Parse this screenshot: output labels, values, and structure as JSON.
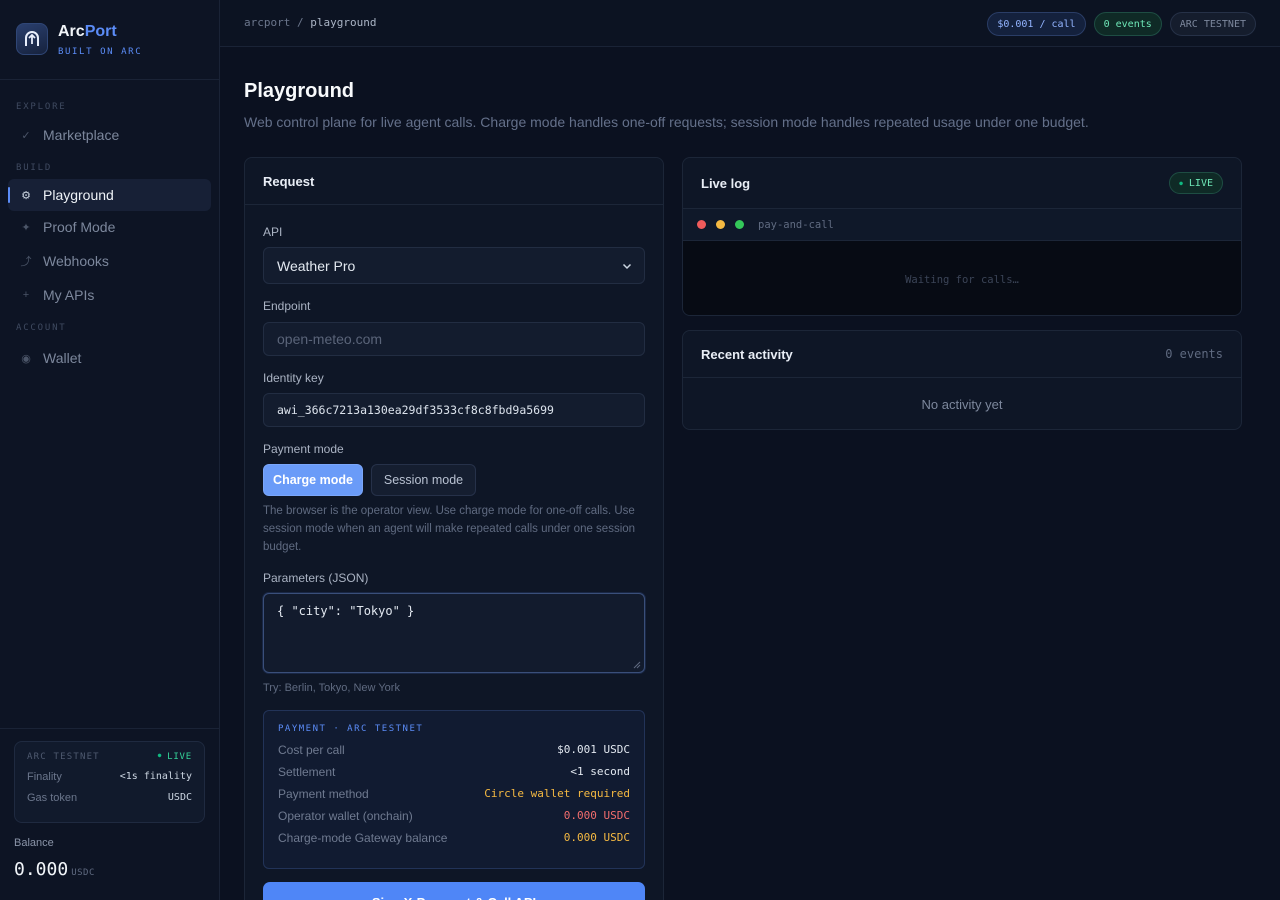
{
  "brand": {
    "name_a": "Arc",
    "name_b": "Port",
    "tagline": "BUILT ON ARC"
  },
  "nav": {
    "explore_label": "EXPLORE",
    "build_label": "BUILD",
    "account_label": "ACCOUNT",
    "items": [
      {
        "label": "Marketplace",
        "icon": "check-icon"
      },
      {
        "label": "Playground",
        "icon": "gear-icon",
        "active": true
      },
      {
        "label": "Proof Mode",
        "icon": "sparkle-icon"
      },
      {
        "label": "Webhooks",
        "icon": "curve-arrow-icon"
      },
      {
        "label": "My APIs",
        "icon": "plus-icon"
      },
      {
        "label": "Wallet",
        "icon": "circle-icon"
      }
    ]
  },
  "network": {
    "name": "ARC TESTNET",
    "status": "LIVE",
    "finality_label": "Finality",
    "finality_value": "<1s finality",
    "gas_label": "Gas token",
    "gas_value": "USDC"
  },
  "balance": {
    "label": "Balance",
    "value": "0.000",
    "unit": "USDC"
  },
  "topbar": {
    "crumb_root": "arcport",
    "crumb_sep": "/",
    "crumb_current": "playground",
    "price_chip": "$0.001 / call",
    "events_chip": "0 events",
    "network_chip": "ARC TESTNET"
  },
  "page": {
    "title": "Playground",
    "subtitle": "Web control plane for live agent calls. Charge mode handles one-off requests; session mode handles repeated usage under one budget."
  },
  "request": {
    "title": "Request",
    "api_label": "API",
    "api_value": "Weather Pro",
    "endpoint_label": "Endpoint",
    "endpoint_placeholder": "open-meteo.com",
    "identity_label": "Identity key",
    "identity_value": "awi_366c7213a130ea29df3533cf8c8fbd9a5699",
    "payment_mode_label": "Payment mode",
    "charge_mode": "Charge mode",
    "session_mode": "Session mode",
    "mode_hint": "The browser is the operator view. Use charge mode for one-off calls. Use session mode when an agent will make repeated calls under one session budget.",
    "params_label": "Parameters (JSON)",
    "params_value": "{ \"city\": \"Tokyo\" }",
    "params_hint": "Try: Berlin, Tokyo, New York",
    "submit_label": "Sign X-Payment & Call API"
  },
  "payment": {
    "header": "PAYMENT · ARC TESTNET",
    "rows": [
      {
        "label": "Cost per call",
        "value": "$0.001 USDC",
        "color": "#e2e8f0"
      },
      {
        "label": "Settlement",
        "value": "<1 second",
        "color": "#e2e8f0"
      },
      {
        "label": "Payment method",
        "value": "Circle wallet required",
        "color": "#f5b942"
      },
      {
        "label": "Operator wallet (onchain)",
        "value": "0.000 USDC",
        "color": "#f26d6d"
      },
      {
        "label": "Charge-mode Gateway balance",
        "value": "0.000 USDC",
        "color": "#f5b942"
      }
    ]
  },
  "live_log": {
    "title": "Live log",
    "badge": "LIVE",
    "terminal_label": "pay-and-call",
    "waiting": "Waiting for calls…"
  },
  "activity": {
    "title": "Recent activity",
    "count": "0 events",
    "empty": "No activity yet"
  },
  "colors": {
    "accent": "#5b8cf7",
    "live": "#10b981",
    "warn": "#f5b942",
    "danger": "#f26d6d"
  }
}
